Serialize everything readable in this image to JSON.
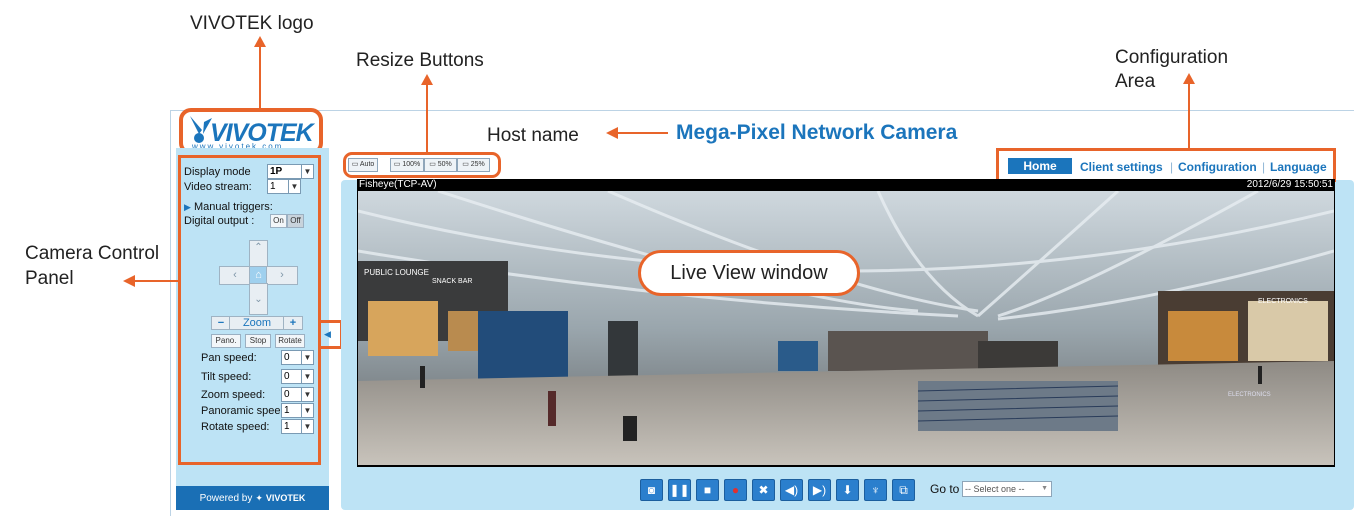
{
  "annotations": {
    "vivotek_logo": "VIVOTEK logo",
    "resize_buttons": "Resize Buttons",
    "host_name": "Host name",
    "configuration_area_line1": "Configuration",
    "configuration_area_line2": "Area",
    "camera_control_line1": "Camera Control",
    "camera_control_line2": "Panel",
    "live_view_window": "Live View window"
  },
  "colors": {
    "annotation_orange": "#e8642a",
    "panel_blue": "#bde3f5",
    "brand_blue": "#1b75bc",
    "footer_blue": "#1a6fb5"
  },
  "logo": {
    "brand": "VIVOTEK",
    "url_text": "www.vivotek.com"
  },
  "header": {
    "host_name": "Mega-Pixel Network Camera"
  },
  "nav": {
    "home": "Home",
    "client_settings": "Client settings",
    "configuration": "Configuration",
    "language": "Language"
  },
  "resize": {
    "auto": "Auto",
    "p100": "100%",
    "p50": "50%",
    "p25": "25%"
  },
  "control_panel": {
    "display_mode_label": "Display mode",
    "display_mode_value": "1P",
    "video_stream_label": "Video stream:",
    "video_stream_value": "1",
    "manual_triggers": "Manual triggers:",
    "digital_output_label": "Digital output :",
    "on": "On",
    "off": "Off",
    "zoom": "Zoom",
    "zoom_minus": "−",
    "zoom_plus": "+",
    "pano": "Pano.",
    "stop": "Stop",
    "rotate": "Rotate",
    "pan_speed_label": "Pan speed:",
    "pan_speed_value": "0",
    "tilt_speed_label": "Tilt speed:",
    "tilt_speed_value": "0",
    "zoom_speed_label": "Zoom speed:",
    "zoom_speed_value": "0",
    "panoramic_speed_label": "Panoramic speed:",
    "panoramic_speed_value": "1",
    "rotate_speed_label": "Rotate speed:",
    "rotate_speed_value": "1"
  },
  "footer": {
    "powered_by": "Powered by",
    "brand": "VIVOTEK"
  },
  "video": {
    "stream_label": "Fisheye(TCP-AV)",
    "timestamp": "2012/6/29 15:50:51",
    "sign_lounge": "PUBLIC LOUNGE",
    "sign_snack": "SNACK BAR",
    "sign_electronics": "ELECTRONICS",
    "sign_electronics_small": "ELECTRONICS"
  },
  "toolbar": {
    "goto_label": "Go to",
    "goto_select": "-- Select one --",
    "icons": [
      "snapshot-icon",
      "pause-icon",
      "stop-icon",
      "record-icon",
      "mute-icon",
      "speaker-icon",
      "talk-icon",
      "download-icon",
      "microphone-icon",
      "fullscreen-icon"
    ]
  }
}
